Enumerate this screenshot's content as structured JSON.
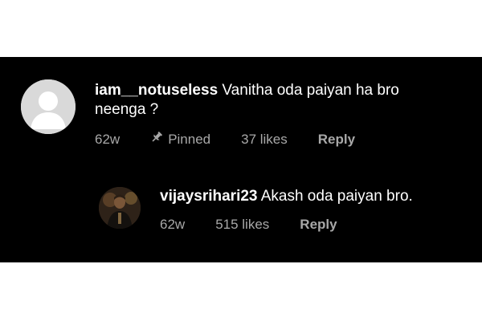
{
  "comments": [
    {
      "username": "iam__notuseless",
      "text": "Vanitha oda paiyan ha bro neenga ?",
      "age": "62w",
      "pinned_label": "Pinned",
      "likes": "37 likes",
      "reply_label": "Reply",
      "avatar_icon": "default-avatar-icon"
    },
    {
      "username": "vijaysrihari23",
      "text": "Akash oda paiyan bro.",
      "age": "62w",
      "likes": "515 likes",
      "reply_label": "Reply",
      "avatar_icon": "user-photo-avatar"
    }
  ],
  "colors": {
    "background": "#000000",
    "text": "#ffffff",
    "meta": "#a8a8a8"
  }
}
